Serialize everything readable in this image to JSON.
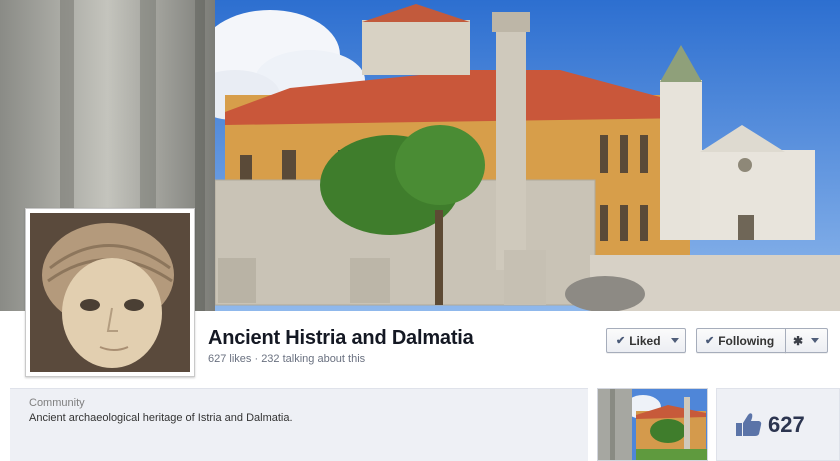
{
  "page": {
    "name": "Ancient Histria and Dalmatia",
    "stats": "627 likes · 232 talking about this"
  },
  "actions": {
    "liked_label": "Liked",
    "following_label": "Following",
    "gear_icon": "gear-icon"
  },
  "about": {
    "category": "Community",
    "description": "Ancient archaeological heritage of Istria and Dalmatia."
  },
  "likes_box": {
    "count": "627",
    "icon": "thumbs-up-icon"
  },
  "colors": {
    "name_text": "#141823",
    "panel_bg": "#eef0f5",
    "button_border": "#a6adbb",
    "likes_text": "#2c3550",
    "thumb_icon": "#5b74a8"
  }
}
